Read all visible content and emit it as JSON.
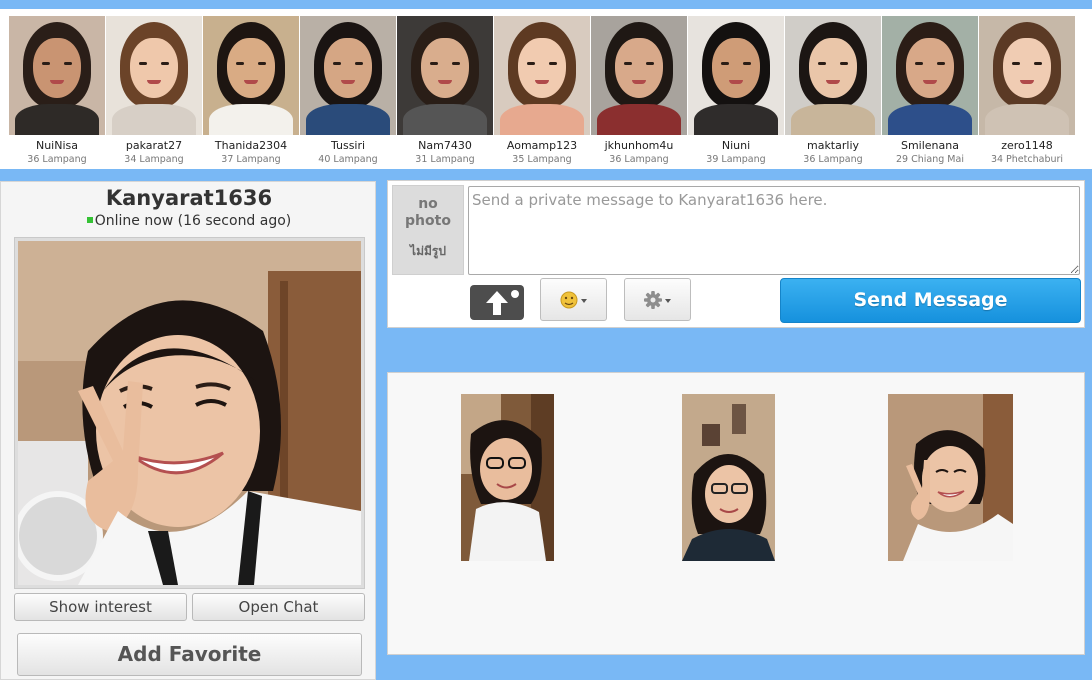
{
  "members": [
    {
      "name": "NuiNisa",
      "meta": "36 Lampang",
      "bg": "#c9b6a6",
      "hair": "#2a1e18",
      "shirt": "#2e2a27",
      "skin": "#c99472"
    },
    {
      "name": "pakarat27",
      "meta": "34 Lampang",
      "bg": "#e8e2da",
      "hair": "#6b4328",
      "shirt": "#d7cfc6",
      "skin": "#efc8ab"
    },
    {
      "name": "Thanida2304",
      "meta": "37 Lampang",
      "bg": "#c8b08e",
      "hair": "#1d1511",
      "shirt": "#f3f1ec",
      "skin": "#d9ab84"
    },
    {
      "name": "Tussiri",
      "meta": "40 Lampang",
      "bg": "#b9b0a6",
      "hair": "#1a1412",
      "shirt": "#2a4b7a",
      "skin": "#d5a684"
    },
    {
      "name": "Nam7430",
      "meta": "31 Lampang",
      "bg": "#3d3a38",
      "hair": "#2a1e17",
      "shirt": "#555",
      "skin": "#d9ad8d"
    },
    {
      "name": "Aomamp123",
      "meta": "35 Lampang",
      "bg": "#d8cbbf",
      "hair": "#5e3a22",
      "shirt": "#e7a98f",
      "skin": "#f1cbb0"
    },
    {
      "name": "jkhunhom4u",
      "meta": "36 Lampang",
      "bg": "#a8a39d",
      "hair": "#1f1814",
      "shirt": "#8b2f2f",
      "skin": "#d8a98a"
    },
    {
      "name": "Niuni",
      "meta": "39 Lampang",
      "bg": "#e7e3de",
      "hair": "#141110",
      "shirt": "#2f2c2b",
      "skin": "#cf9c77"
    },
    {
      "name": "maktarliy",
      "meta": "36 Lampang",
      "bg": "#d0cdc8",
      "hair": "#1c1613",
      "shirt": "#c8b59a",
      "skin": "#eac6a9"
    },
    {
      "name": "Smilenana",
      "meta": "29 Chiang Mai",
      "bg": "#a3b0a6",
      "hair": "#2b1d16",
      "shirt": "#2d4f8a",
      "skin": "#d8a888"
    },
    {
      "name": "zero1148",
      "meta": "34 Phetchaburi",
      "bg": "#c6b8a8",
      "hair": "#5b3a25",
      "shirt": "#cfc2b4",
      "skin": "#f0ccb3"
    }
  ],
  "profile": {
    "username": "Kanyarat1636",
    "status": "Online now (16 second ago)",
    "status_color": "#35c235"
  },
  "actions": {
    "show_interest": "Show interest",
    "open_chat": "Open Chat",
    "add_favorite": "Add Favorite"
  },
  "message": {
    "no_photo_line1": "no",
    "no_photo_line2": "photo",
    "no_photo_thai": "ไม่มีรูป",
    "placeholder": "Send a private message to Kanyarat1636 here.",
    "value": "",
    "camera_icon": "camera-upload-icon",
    "emoji_icon": "smiley-icon",
    "gear_icon": "gear-icon",
    "send_label": "Send Message"
  },
  "colors": {
    "page_bg": "#79b8f5",
    "send_button": "#1e9be6"
  }
}
